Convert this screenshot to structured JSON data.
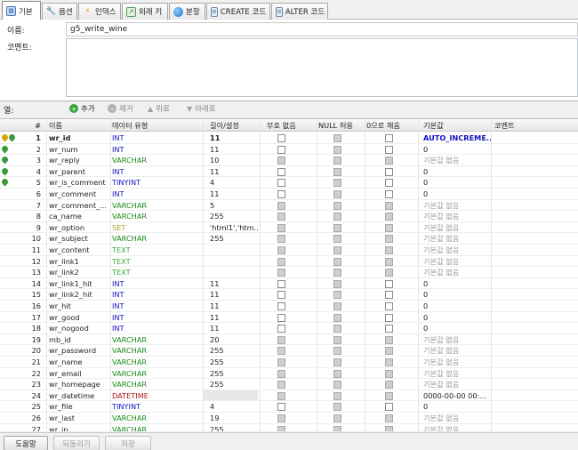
{
  "tabs": [
    {
      "label": "기본",
      "icon": "table-icon",
      "active": true
    },
    {
      "label": "옵션",
      "icon": "wrench-icon",
      "active": false
    },
    {
      "label": "인덱스",
      "icon": "lightning-icon",
      "active": false
    },
    {
      "label": "외래 키",
      "icon": "foreign-key-icon",
      "active": false
    },
    {
      "label": "분할",
      "icon": "partition-icon",
      "active": false
    },
    {
      "label": "CREATE 코드",
      "icon": "code-icon",
      "active": false
    },
    {
      "label": "ALTER 코드",
      "icon": "code-icon",
      "active": false
    }
  ],
  "form": {
    "name_label": "이름:",
    "name_value": "g5_write_wine",
    "comment_label": "코멘트:"
  },
  "toolbar": {
    "title": "열:",
    "add": "추가",
    "remove": "제거",
    "up": "위로",
    "down": "아래로"
  },
  "columns": [
    "#",
    "이름",
    "데이터 유형",
    "길이/설정",
    "부호 없음",
    "NULL 허용",
    "0으로 채움",
    "기본값",
    "코멘트"
  ],
  "colors": {
    "type_int": "#1010c0",
    "type_varchar": "#1a8a1a",
    "type_text": "#3aaa3a",
    "type_set": "#a8a020",
    "type_datetime": "#b01010",
    "primary_key": "#d4a800",
    "index_key": "#3a9a3a",
    "auto_increment": "#1010c0",
    "default_gray": "#999999"
  },
  "rows": [
    {
      "num": "1",
      "name": "wr_id",
      "type": "INT",
      "tclass": "int",
      "len": "11",
      "uns": "box",
      "null": "dis",
      "zero": "box",
      "def": "AUTO_INCREME...",
      "dclass": "auto",
      "keys": [
        "pk",
        "idx"
      ],
      "bold": true
    },
    {
      "num": "2",
      "name": "wr_num",
      "type": "INT",
      "tclass": "int",
      "len": "11",
      "uns": "box",
      "null": "dis",
      "zero": "box",
      "def": "0",
      "dclass": "plain",
      "keys": [
        "idx"
      ]
    },
    {
      "num": "3",
      "name": "wr_reply",
      "type": "VARCHAR",
      "tclass": "varchar",
      "len": "10",
      "uns": "dis",
      "null": "dis",
      "zero": "dis",
      "def": "기본값 없음",
      "dclass": "gray",
      "keys": [
        "idx"
      ]
    },
    {
      "num": "4",
      "name": "wr_parent",
      "type": "INT",
      "tclass": "int",
      "len": "11",
      "uns": "box",
      "null": "dis",
      "zero": "box",
      "def": "0",
      "dclass": "plain",
      "keys": [
        "idx"
      ]
    },
    {
      "num": "5",
      "name": "wr_is_comment",
      "type": "TINYINT",
      "tclass": "int",
      "len": "4",
      "uns": "box",
      "null": "dis",
      "zero": "box",
      "def": "0",
      "dclass": "plain",
      "keys": [
        "idx"
      ]
    },
    {
      "num": "6",
      "name": "wr_comment",
      "type": "INT",
      "tclass": "int",
      "len": "11",
      "uns": "box",
      "null": "dis",
      "zero": "box",
      "def": "0",
      "dclass": "plain",
      "keys": []
    },
    {
      "num": "7",
      "name": "wr_comment_...",
      "type": "VARCHAR",
      "tclass": "varchar",
      "len": "5",
      "uns": "dis",
      "null": "dis",
      "zero": "dis",
      "def": "기본값 없음",
      "dclass": "gray",
      "keys": []
    },
    {
      "num": "8",
      "name": "ca_name",
      "type": "VARCHAR",
      "tclass": "varchar",
      "len": "255",
      "uns": "dis",
      "null": "dis",
      "zero": "dis",
      "def": "기본값 없음",
      "dclass": "gray",
      "keys": []
    },
    {
      "num": "9",
      "name": "wr_option",
      "type": "SET",
      "tclass": "set",
      "len": "'html1','htm...",
      "uns": "dis",
      "null": "dis",
      "zero": "dis",
      "def": "기본값 없음",
      "dclass": "gray",
      "keys": []
    },
    {
      "num": "10",
      "name": "wr_subject",
      "type": "VARCHAR",
      "tclass": "varchar",
      "len": "255",
      "uns": "dis",
      "null": "dis",
      "zero": "dis",
      "def": "기본값 없음",
      "dclass": "gray",
      "keys": []
    },
    {
      "num": "11",
      "name": "wr_content",
      "type": "TEXT",
      "tclass": "text",
      "len": "",
      "uns": "dis",
      "null": "dis",
      "zero": "dis",
      "def": "기본값 없음",
      "dclass": "gray",
      "keys": []
    },
    {
      "num": "12",
      "name": "wr_link1",
      "type": "TEXT",
      "tclass": "text",
      "len": "",
      "uns": "dis",
      "null": "dis",
      "zero": "dis",
      "def": "기본값 없음",
      "dclass": "gray",
      "keys": []
    },
    {
      "num": "13",
      "name": "wr_link2",
      "type": "TEXT",
      "tclass": "text",
      "len": "",
      "uns": "dis",
      "null": "dis",
      "zero": "dis",
      "def": "기본값 없음",
      "dclass": "gray",
      "keys": []
    },
    {
      "num": "14",
      "name": "wr_link1_hit",
      "type": "INT",
      "tclass": "int",
      "len": "11",
      "uns": "box",
      "null": "dis",
      "zero": "box",
      "def": "0",
      "dclass": "plain",
      "keys": []
    },
    {
      "num": "15",
      "name": "wr_link2_hit",
      "type": "INT",
      "tclass": "int",
      "len": "11",
      "uns": "box",
      "null": "dis",
      "zero": "box",
      "def": "0",
      "dclass": "plain",
      "keys": []
    },
    {
      "num": "16",
      "name": "wr_hit",
      "type": "INT",
      "tclass": "int",
      "len": "11",
      "uns": "box",
      "null": "dis",
      "zero": "box",
      "def": "0",
      "dclass": "plain",
      "keys": []
    },
    {
      "num": "17",
      "name": "wr_good",
      "type": "INT",
      "tclass": "int",
      "len": "11",
      "uns": "box",
      "null": "dis",
      "zero": "box",
      "def": "0",
      "dclass": "plain",
      "keys": []
    },
    {
      "num": "18",
      "name": "wr_nogood",
      "type": "INT",
      "tclass": "int",
      "len": "11",
      "uns": "box",
      "null": "dis",
      "zero": "box",
      "def": "0",
      "dclass": "plain",
      "keys": []
    },
    {
      "num": "19",
      "name": "mb_id",
      "type": "VARCHAR",
      "tclass": "varchar",
      "len": "20",
      "uns": "dis",
      "null": "dis",
      "zero": "dis",
      "def": "기본값 없음",
      "dclass": "gray",
      "keys": []
    },
    {
      "num": "20",
      "name": "wr_password",
      "type": "VARCHAR",
      "tclass": "varchar",
      "len": "255",
      "uns": "dis",
      "null": "dis",
      "zero": "dis",
      "def": "기본값 없음",
      "dclass": "gray",
      "keys": []
    },
    {
      "num": "21",
      "name": "wr_name",
      "type": "VARCHAR",
      "tclass": "varchar",
      "len": "255",
      "uns": "dis",
      "null": "dis",
      "zero": "dis",
      "def": "기본값 없음",
      "dclass": "gray",
      "keys": []
    },
    {
      "num": "22",
      "name": "wr_email",
      "type": "VARCHAR",
      "tclass": "varchar",
      "len": "255",
      "uns": "dis",
      "null": "dis",
      "zero": "dis",
      "def": "기본값 없음",
      "dclass": "gray",
      "keys": []
    },
    {
      "num": "23",
      "name": "wr_homepage",
      "type": "VARCHAR",
      "tclass": "varchar",
      "len": "255",
      "uns": "dis",
      "null": "dis",
      "zero": "dis",
      "def": "기본값 없음",
      "dclass": "gray",
      "keys": []
    },
    {
      "num": "24",
      "name": "wr_datetime",
      "type": "DATETIME",
      "tclass": "datetime",
      "len": "",
      "lenShade": true,
      "uns": "dis",
      "null": "dis",
      "zero": "dis",
      "def": "0000-00-00 00:...",
      "dclass": "plain",
      "keys": []
    },
    {
      "num": "25",
      "name": "wr_file",
      "type": "TINYINT",
      "tclass": "int",
      "len": "4",
      "uns": "box",
      "null": "dis",
      "zero": "box",
      "def": "0",
      "dclass": "plain",
      "keys": []
    },
    {
      "num": "26",
      "name": "wr_last",
      "type": "VARCHAR",
      "tclass": "varchar",
      "len": "19",
      "uns": "dis",
      "null": "dis",
      "zero": "dis",
      "def": "기본값 없음",
      "dclass": "gray",
      "keys": []
    },
    {
      "num": "27",
      "name": "wr_ip",
      "type": "VARCHAR",
      "tclass": "varchar",
      "len": "255",
      "uns": "dis",
      "null": "dis",
      "zero": "dis",
      "def": "기본값 없음",
      "dclass": "gray",
      "keys": []
    }
  ],
  "bottom": {
    "help": "도움말",
    "revert": "되돌리기",
    "save": "저장"
  }
}
